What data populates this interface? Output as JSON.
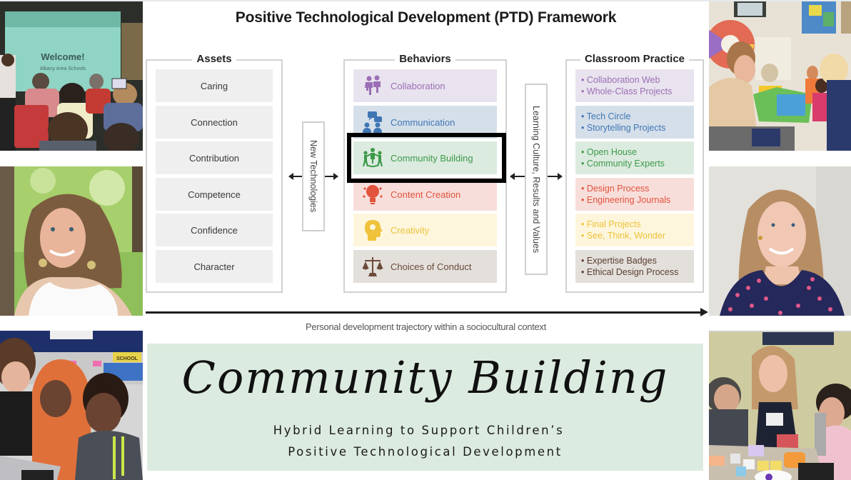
{
  "diagram": {
    "title": "Positive Technological Development (PTD) Framework",
    "assets": {
      "label": "Assets",
      "items": [
        "Caring",
        "Connection",
        "Contribution",
        "Competence",
        "Confidence",
        "Character"
      ]
    },
    "new_technologies_label": "New Technologies",
    "behaviors": {
      "label": "Behaviors",
      "highlighted": "Community Building",
      "items": [
        {
          "label": "Collaboration",
          "icon": "collaboration-people-icon",
          "color": "#9b6fb5",
          "bg": "#e8e3ee"
        },
        {
          "label": "Communication",
          "icon": "communication-chat-icon",
          "color": "#3f76b4",
          "bg": "#d5dfea"
        },
        {
          "label": "Community Building",
          "icon": "community-circle-icon",
          "color": "#3d9a4a",
          "bg": "#dcebdf"
        },
        {
          "label": "Content Creation",
          "icon": "content-creation-bulb-icon",
          "color": "#e2533c",
          "bg": "#f8dedb"
        },
        {
          "label": "Creativity",
          "icon": "creativity-head-icon",
          "color": "#eec23a",
          "bg": "#fdf6dc"
        },
        {
          "label": "Choices of Conduct",
          "icon": "scales-icon",
          "color": "#6b4a3a",
          "bg": "#e3dfdb"
        }
      ]
    },
    "learning_culture_label": "Learning Culture, Results and Values",
    "classroom_practice": {
      "label": "Classroom Practice",
      "items": [
        {
          "lines": [
            "Collaboration Web",
            "Whole-Class Projects"
          ],
          "color": "#9b6fb5",
          "bg": "#e8e3ee"
        },
        {
          "lines": [
            "Tech Circle",
            "Storytelling Projects"
          ],
          "color": "#3f76b4",
          "bg": "#d5dfea"
        },
        {
          "lines": [
            "Open House",
            "Community Experts"
          ],
          "color": "#3d9a4a",
          "bg": "#dcebdf"
        },
        {
          "lines": [
            "Design Process",
            "Engineering Journals"
          ],
          "color": "#e2533c",
          "bg": "#f8dedb"
        },
        {
          "lines": [
            "Final Projects",
            "See, Think, Wonder"
          ],
          "color": "#eec23a",
          "bg": "#fdf6dc"
        },
        {
          "lines": [
            "Expertise Badges",
            "Ethical Design Process"
          ],
          "color": "#5a3e31",
          "bg": "#e3dfdb"
        }
      ]
    },
    "trajectory_label": "Personal development trajectory within a sociocultural context"
  },
  "banner": {
    "title": "Community Building",
    "subtitle_line1": "Hybrid Learning to Support Children’s",
    "subtitle_line2": "Positive Technological Development",
    "bg": "#dcebdf"
  },
  "photos": {
    "left": [
      {
        "name": "workshop-presentation-photo",
        "screen_text": "Welcome!",
        "screen_subtext": "Albany Area Schools"
      },
      {
        "name": "portrait-woman-curly-hair-photo"
      },
      {
        "name": "teacher-students-laptop-photo",
        "sign_text": "SCHOOL"
      }
    ],
    "right": [
      {
        "name": "teacher-reading-to-children-photo"
      },
      {
        "name": "portrait-woman-long-hair-photo"
      },
      {
        "name": "robotics-workshop-photo"
      }
    ]
  }
}
